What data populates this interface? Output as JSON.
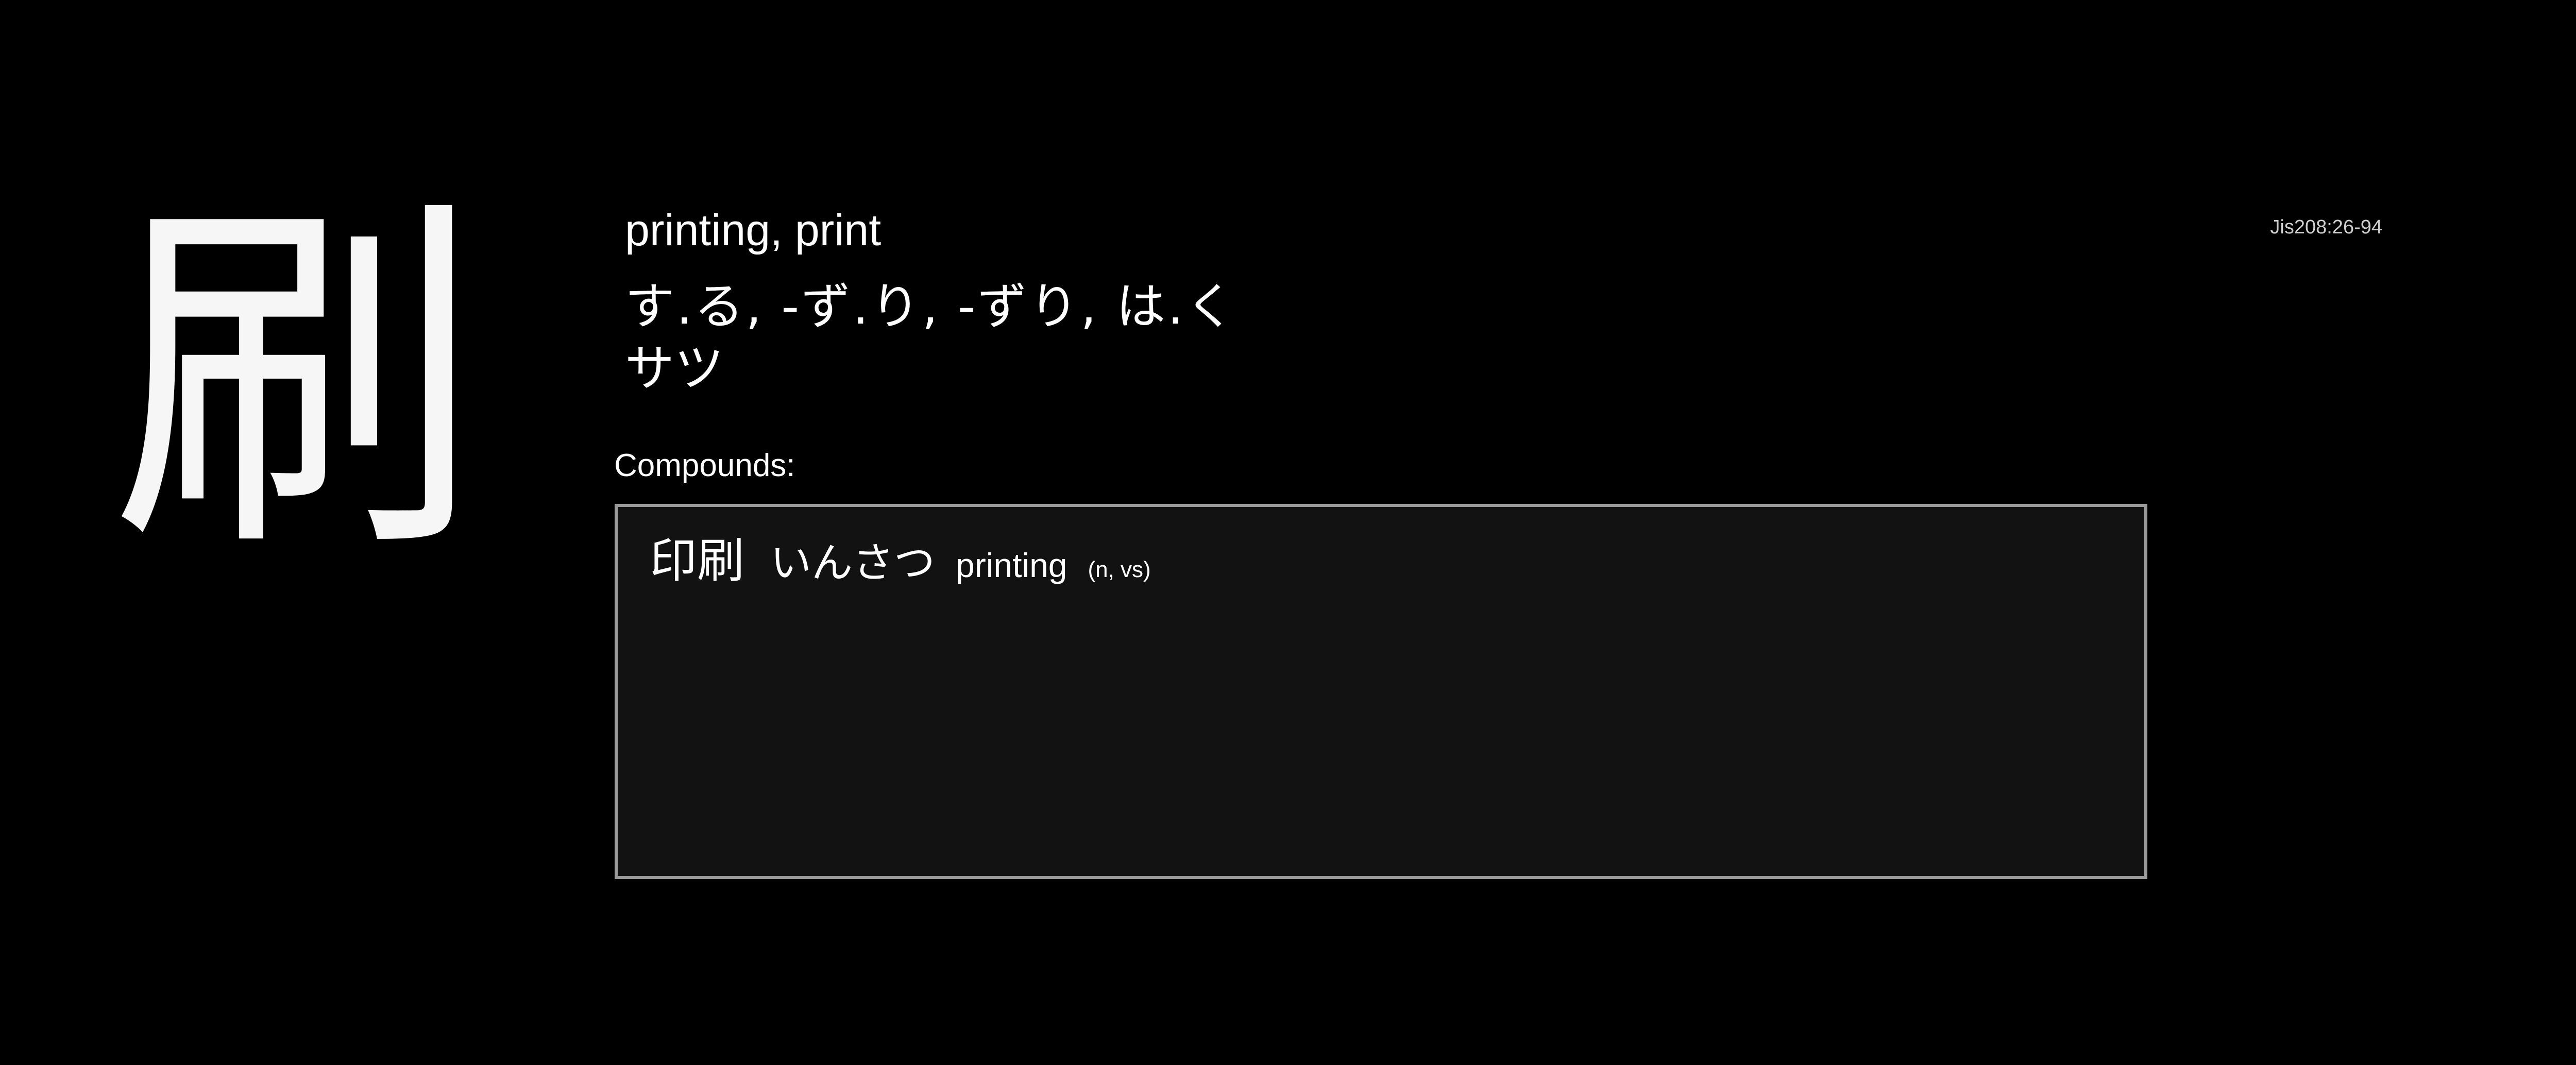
{
  "kanji": {
    "character": "刷",
    "meanings": "printing, print",
    "kun_readings": "す.る, -ず.り, -ずり, は.く",
    "on_readings": "サツ",
    "jis_code": "Jis208:26-94"
  },
  "compounds": {
    "label": "Compounds:",
    "items": [
      {
        "word": "印刷",
        "reading": "いんさつ",
        "meaning": "printing",
        "pos": "(n, vs)"
      }
    ]
  },
  "colors": {
    "background": "#000000",
    "text": "#ffffff",
    "box_background": "#121212",
    "box_border": "#9a9a9a"
  }
}
